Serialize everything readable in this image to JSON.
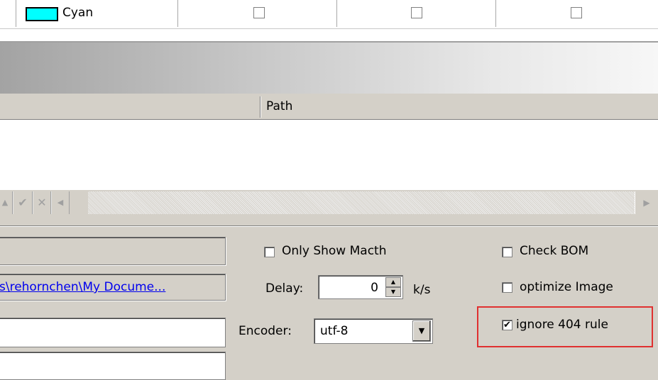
{
  "grid_top": {
    "color_name": "Cyan",
    "color_hex": "#00ffff",
    "checkboxes": [
      false,
      false,
      false
    ]
  },
  "columns": {
    "path_header": "Path"
  },
  "navigator": {
    "icons": [
      "up-icon",
      "check-icon",
      "cancel-icon",
      "left-arrow-icon"
    ],
    "up_glyph": "▲",
    "check_glyph": "✔",
    "cancel_glyph": "✕",
    "left_glyph": "◀",
    "right_glyph": "▶"
  },
  "options": {
    "path_link": "s\\rehornchen\\My Docume...",
    "only_show_match_label": "Only Show Macth",
    "only_show_match_checked": false,
    "delay_label": "Delay:",
    "delay_value": "0",
    "delay_unit": "k/s",
    "encoder_label": "Encoder:",
    "encoder_value": "utf-8",
    "check_bom_label": "Check BOM",
    "check_bom_checked": false,
    "optimize_image_label": "optimize Image",
    "optimize_image_checked": false,
    "ignore_404_label": "ignore 404 rule",
    "ignore_404_checked": true,
    "check_mark": "✔",
    "spin_up": "▲",
    "spin_down": "▼",
    "dropdown_glyph": "▼"
  },
  "colors": {
    "highlight": "#e03030",
    "link": "#0000ee",
    "window_bg": "#d4d0c8"
  }
}
